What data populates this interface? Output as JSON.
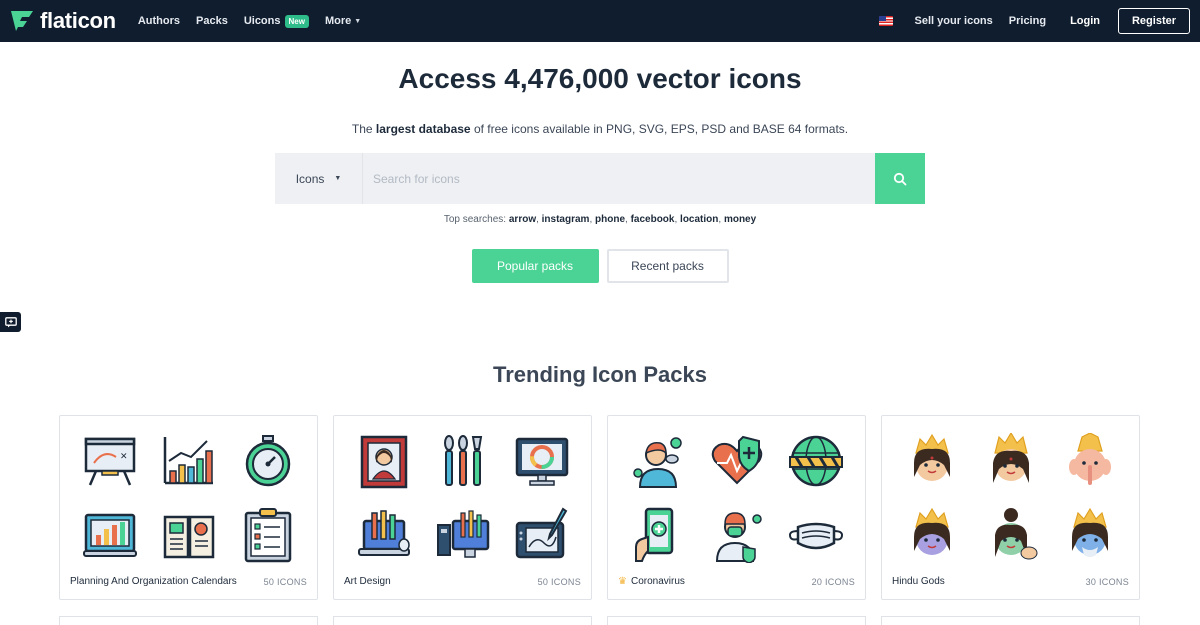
{
  "nav": {
    "logo_text": "flaticon",
    "links": {
      "authors": "Authors",
      "packs": "Packs",
      "uicons": "Uicons",
      "new_badge": "New",
      "more": "More"
    },
    "sell": "Sell your icons",
    "pricing": "Pricing",
    "login": "Login",
    "register": "Register"
  },
  "hero": {
    "title": "Access 4,476,000 vector icons",
    "sub_pre": "The",
    "sub_bold": "largest database",
    "sub_post": "of free icons available in PNG, SVG, EPS, PSD and BASE 64 formats."
  },
  "search": {
    "type_label": "Icons",
    "placeholder": "Search for icons"
  },
  "top_searches": {
    "label": "Top searches:",
    "items": [
      "arrow",
      "instagram",
      "phone",
      "facebook",
      "location",
      "money"
    ]
  },
  "pack_buttons": {
    "popular": "Popular packs",
    "recent": "Recent packs"
  },
  "section_title": "Trending Icon Packs",
  "cards": [
    {
      "name": "Planning And Organization Calendars",
      "count": "50 ICONS"
    },
    {
      "name": "Art Design",
      "count": "50 ICONS"
    },
    {
      "name": "Coronavirus",
      "count": "20 ICONS",
      "premium": true
    },
    {
      "name": "Hindu Gods",
      "count": "30 ICONS"
    }
  ],
  "colors": {
    "nav_bg": "#0f1d2e",
    "accent": "#4bd395",
    "text_dark": "#1d2a3a"
  }
}
